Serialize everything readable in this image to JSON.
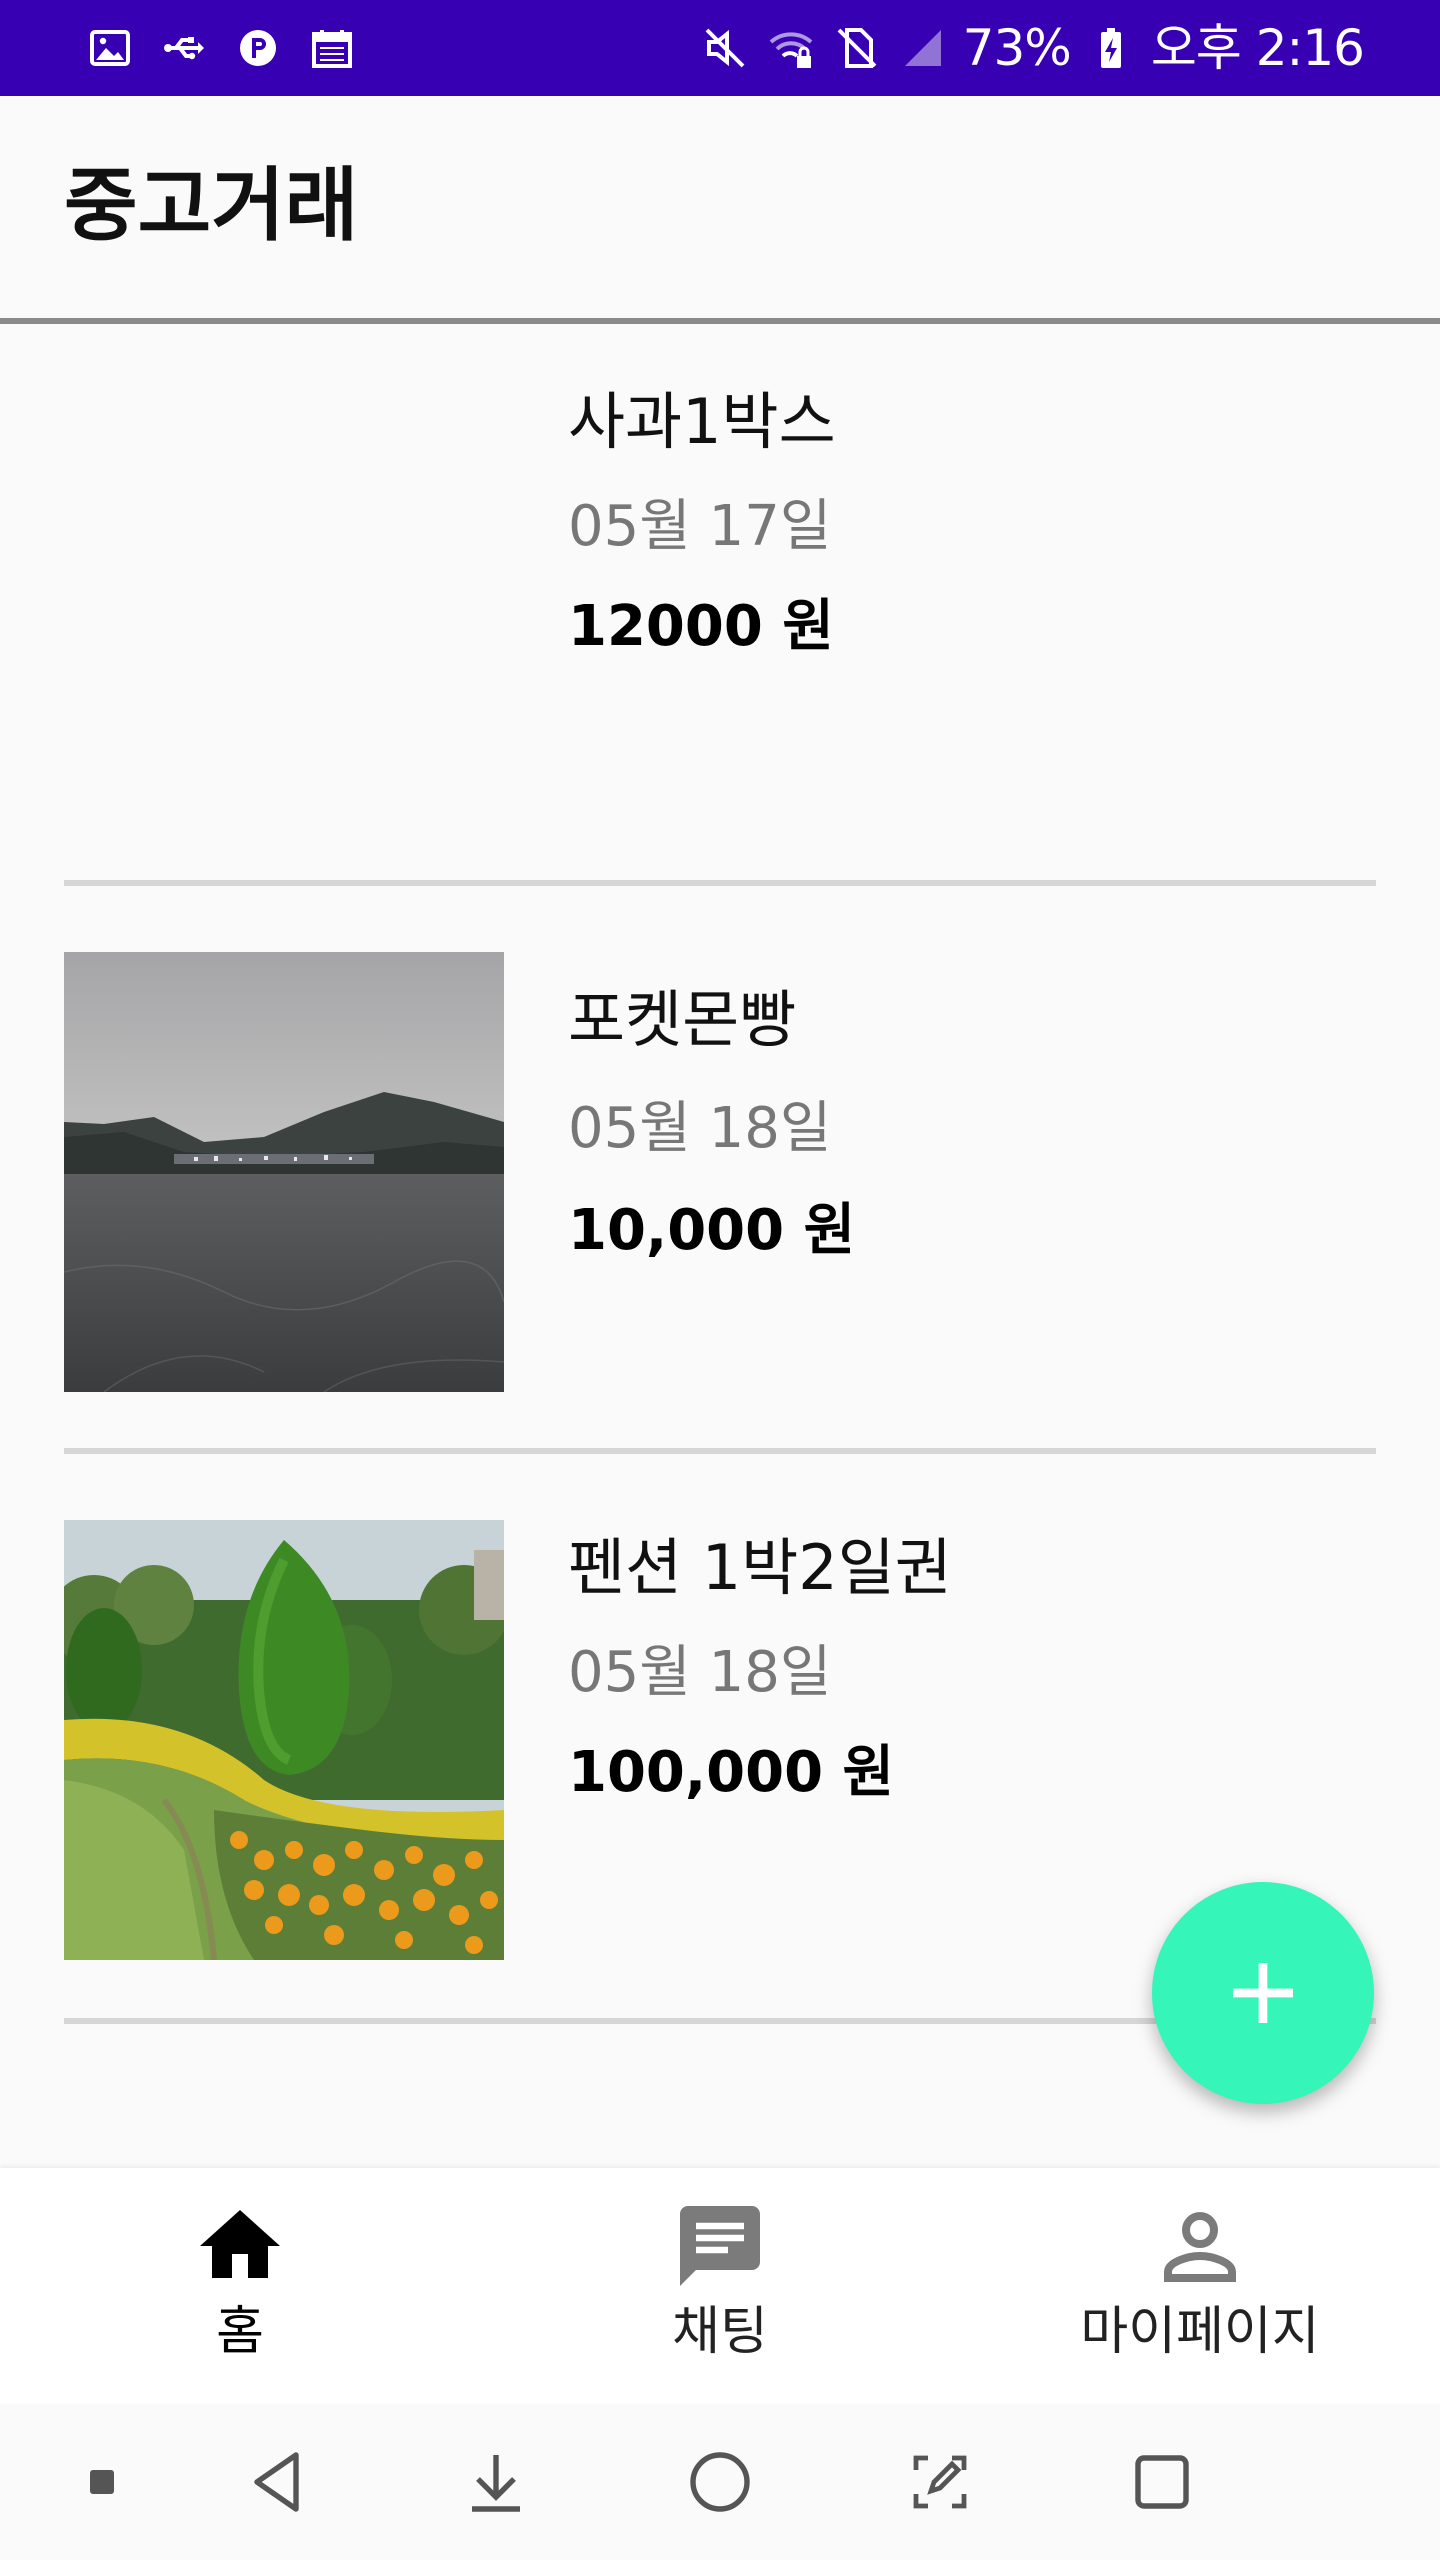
{
  "status_bar": {
    "battery": "73%",
    "time": "오후 2:16",
    "left_icons": [
      "image-icon",
      "usb-icon",
      "p-badge-icon",
      "calendar-icon"
    ],
    "right_icons": [
      "mute-icon",
      "wifi-lock-icon",
      "no-sim-icon",
      "signal-icon",
      "battery-charging-icon"
    ],
    "background": "#3700b3"
  },
  "app_bar": {
    "title": "중고거래"
  },
  "items": [
    {
      "title": "사과1박스",
      "date": "05월 17일",
      "price": "12000 원",
      "has_image": false
    },
    {
      "title": "포켓몬빵",
      "date": "05월 18일",
      "price": "10,000 원",
      "has_image": true,
      "image_desc": "lake-photo"
    },
    {
      "title": "펜션 1박2일권",
      "date": "05월 18일",
      "price": "100,000 원",
      "has_image": true,
      "image_desc": "garden-photo"
    }
  ],
  "fab": {
    "icon": "plus-icon",
    "color": "#35f5b8"
  },
  "bottom_nav": {
    "items": [
      {
        "label": "홈",
        "icon": "home-icon",
        "active": true
      },
      {
        "label": "채팅",
        "icon": "chat-icon",
        "active": false
      },
      {
        "label": "마이페이지",
        "icon": "person-icon",
        "active": false
      }
    ]
  },
  "system_nav": {
    "buttons": [
      "dot-icon",
      "back-icon",
      "download-icon",
      "home-circle-icon",
      "edit-screenshot-icon",
      "recents-icon"
    ]
  }
}
